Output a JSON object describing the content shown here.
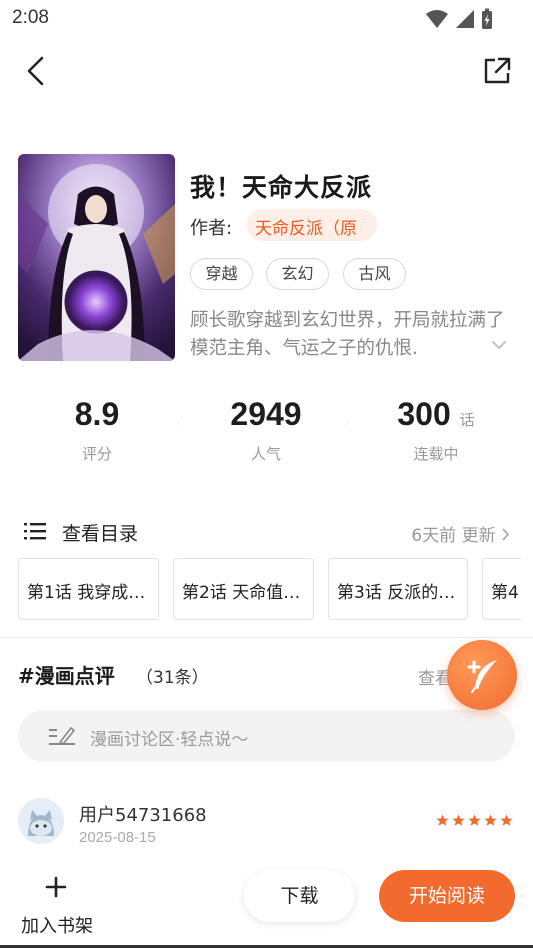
{
  "status_bar": {
    "time": "2:08"
  },
  "book": {
    "title": "我！天命大反派",
    "author_label": "作者:",
    "author": "天命反派（原",
    "tags": [
      "穿越",
      "玄幻",
      "古风"
    ],
    "description": "顾长歌穿越到玄幻世界，开局就拉满了模范主角、气运之子的仇恨."
  },
  "stats": {
    "rating": {
      "value": "8.9",
      "label": "评分"
    },
    "popularity": {
      "value": "2949",
      "label": "人气"
    },
    "chapters": {
      "value": "300",
      "unit": "话",
      "label": "连载中"
    }
  },
  "toc": {
    "label": "查看目录",
    "update": "6天前 更新",
    "chapters": [
      "第1话 我穿成…",
      "第2话 天命值…",
      "第3话 反派的…",
      "第4"
    ]
  },
  "reviews": {
    "title": "#漫画点评",
    "count": "（31条）",
    "more": "查看",
    "input_placeholder": "漫画讨论区·轻点说～",
    "items": [
      {
        "user": "用户54731668",
        "date": "2025-08-15",
        "rating": 5
      }
    ]
  },
  "bottom": {
    "shelf_label": "加入书架",
    "download_label": "下载",
    "read_label": "开始阅读"
  },
  "colors": {
    "accent": "#f26a2e",
    "accent_light": "#fdeee6"
  },
  "icons": [
    "back-icon",
    "share-icon",
    "list-icon",
    "chevron-right-icon",
    "chevron-down-icon",
    "edit-icon",
    "quill-plus-icon",
    "plus-icon",
    "star-icon",
    "wifi-icon",
    "signal-icon",
    "battery-icon"
  ]
}
